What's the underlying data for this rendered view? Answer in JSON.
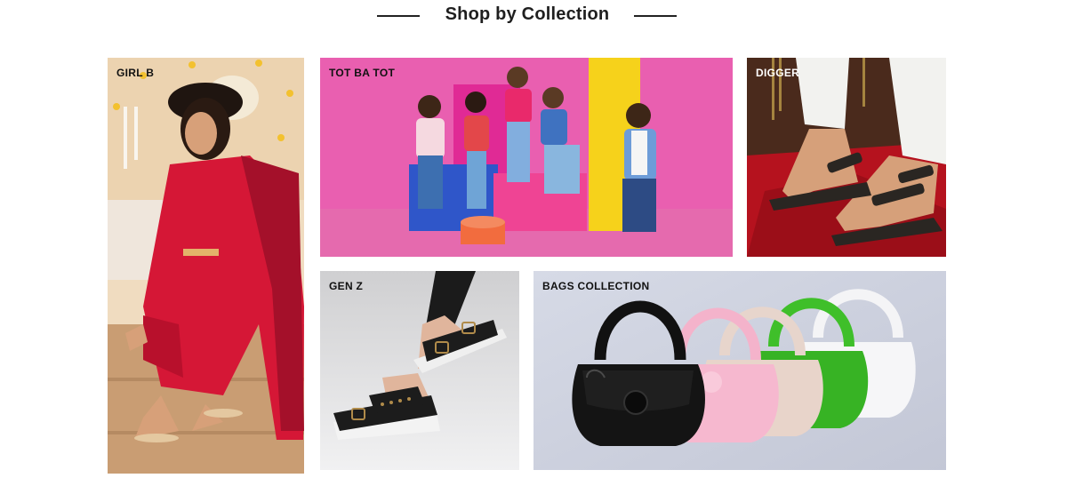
{
  "section": {
    "title": "Shop by Collection"
  },
  "collections": [
    {
      "label": "GIRL B"
    },
    {
      "label": "TOT BA TOT"
    },
    {
      "label": "DIGGER"
    },
    {
      "label": "GEN Z"
    },
    {
      "label": "BAGS COLLECTION"
    }
  ],
  "colors": {
    "heading": "#1f1f1f",
    "accent_pink": "#e85aa8",
    "accent_red": "#c8102e"
  }
}
